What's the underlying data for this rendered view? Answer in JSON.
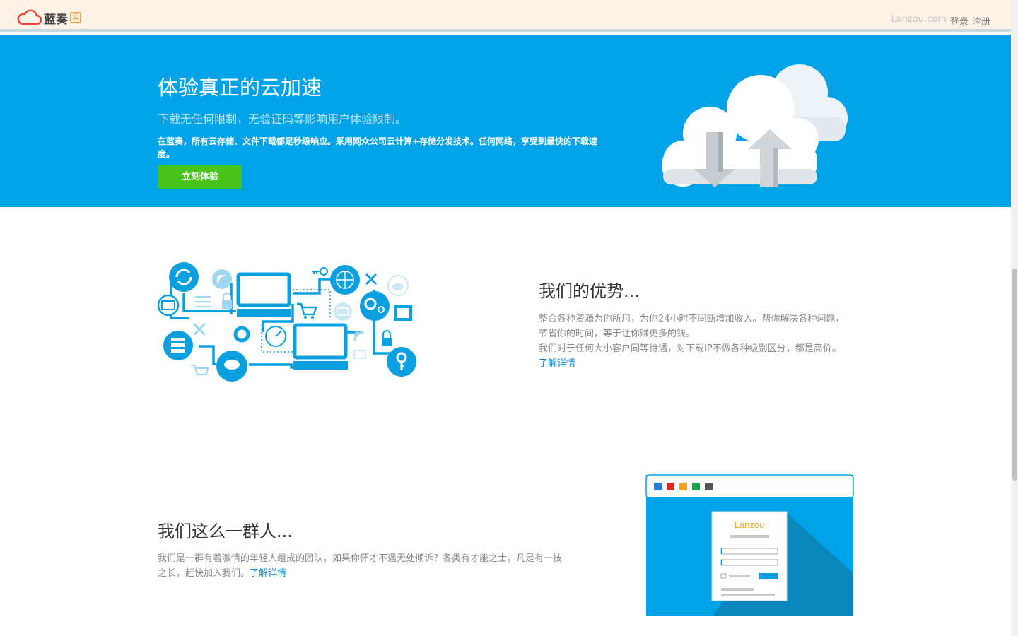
{
  "header": {
    "logo_text": "蓝奏",
    "logo_badge": "云",
    "domain": "Lanzou.com",
    "login": "登录",
    "register": "注册"
  },
  "hero": {
    "title": "体验真正的云加速",
    "subtitle": "下载无任何限制，无验证码等影响用户体验限制。",
    "description": "在蓝奏，所有云存储、文件下载都是秒级响应。采用网众公司云计算+存储分发技术。任何网络，享受到最快的下载速度。",
    "button": "立刻体验"
  },
  "advantages": {
    "title": "我们的优势...",
    "line1": "整合各种资源为你所用，为你24小时不间断增加收入。帮你解决各种问题，节省你的时间，等于让你赚更多的钱。",
    "line2": "我们对于任何大小客户同等待遇，对下载IP不做各种级别区分，都是高价。",
    "link": "了解详情"
  },
  "team": {
    "title": "我们这么一群人...",
    "body": "我们是一群有着激情的年轻人组成的团队，如果你怀才不遇无处倾诉？各类有才能之士，凡是有一技之长，赶快加入我们。",
    "link": "了解详情"
  },
  "browser_mock": {
    "brand": "Lanzou",
    "dot_colors": [
      "#1e7fe0",
      "#e0241d",
      "#f3a51c",
      "#1aa447",
      "#555555"
    ]
  },
  "colors": {
    "hero_bg": "#00a2e8",
    "button_green": "#49c21a",
    "link_blue": "#0a88d8",
    "topbar_bg": "#fdf3e6"
  }
}
